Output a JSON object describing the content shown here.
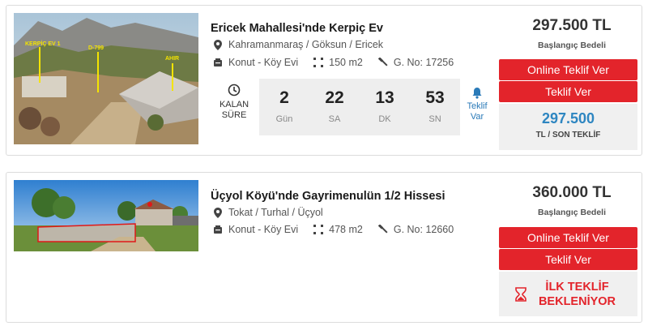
{
  "listings": [
    {
      "title": "Ericek Mahallesi'nde Kerpiç Ev",
      "location": "Kahramanmaraş / Göksun / Ericek",
      "category": "Konut - Köy Evi",
      "area": "150 m2",
      "listing_no": "G. No: 17256",
      "photo_labels": [
        "KERPİÇ EV 1",
        "D-799",
        "AHIR"
      ],
      "countdown": {
        "label": "KALAN SÜRE",
        "cells": [
          {
            "value": "2",
            "unit": "Gün"
          },
          {
            "value": "22",
            "unit": "SA"
          },
          {
            "value": "13",
            "unit": "DK"
          },
          {
            "value": "53",
            "unit": "SN"
          }
        ]
      },
      "bid_alert": "Teklif Var",
      "start_price": "297.500 TL",
      "start_price_label": "Başlangıç Bedeli",
      "online_bid_button": "Online Teklif Ver",
      "bid_button": "Teklif Ver",
      "last_bid_value": "297.500",
      "last_bid_label": "TL / SON TEKLİF"
    },
    {
      "title": "Üçyol Köyü'nde Gayrimenulün 1/2 Hissesi",
      "location": "Tokat / Turhal / Üçyol",
      "category": "Konut - Köy Evi",
      "area": "478 m2",
      "listing_no": "G. No: 12660",
      "start_price": "360.000 TL",
      "start_price_label": "Başlangıç Bedeli",
      "online_bid_button": "Online Teklif Ver",
      "bid_button": "Teklif Ver",
      "waiting_text": "İLK TEKLİF BEKLENİYOR"
    }
  ],
  "colors": {
    "accent_red": "#e3242b",
    "accent_blue": "#2e86c1",
    "panel_gray": "#f0f0f0"
  }
}
